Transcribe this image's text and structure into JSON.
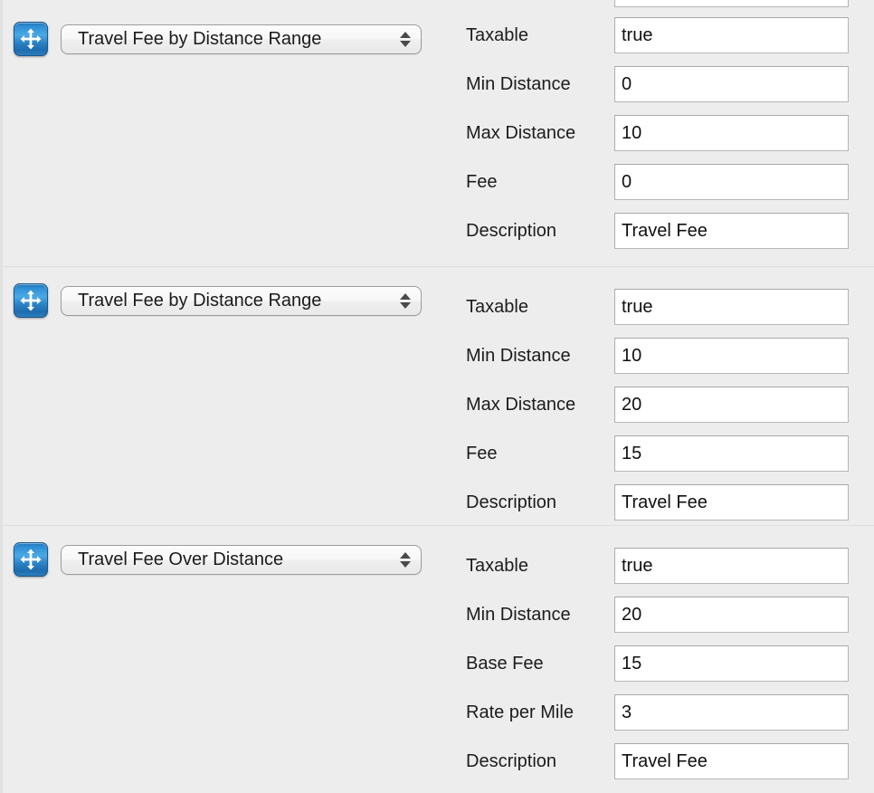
{
  "colors": {
    "page_background": "#ededed",
    "handle_blue": "#2f8fd4",
    "input_background": "#ffffff",
    "input_border": "#b7b7b7",
    "text": "#1c1c1c"
  },
  "top_clipped_field": {
    "name": "clipped-field-above",
    "value": ""
  },
  "groups": [
    {
      "handle_icon": "move-arrows-icon",
      "type_label": "Travel Fee by Distance Range",
      "fields": [
        {
          "label": "Taxable",
          "value": "true"
        },
        {
          "label": "Min Distance",
          "value": "0"
        },
        {
          "label": "Max Distance",
          "value": "10"
        },
        {
          "label": "Fee",
          "value": "0"
        },
        {
          "label": "Description",
          "value": "Travel Fee"
        }
      ]
    },
    {
      "handle_icon": "move-arrows-icon",
      "type_label": "Travel Fee by Distance Range",
      "fields": [
        {
          "label": "Taxable",
          "value": "true"
        },
        {
          "label": "Min Distance",
          "value": "10"
        },
        {
          "label": "Max Distance",
          "value": "20"
        },
        {
          "label": "Fee",
          "value": "15"
        },
        {
          "label": "Description",
          "value": "Travel Fee"
        }
      ]
    },
    {
      "handle_icon": "move-arrows-icon",
      "type_label": "Travel Fee Over Distance",
      "fields": [
        {
          "label": "Taxable",
          "value": "true"
        },
        {
          "label": "Min Distance",
          "value": "20"
        },
        {
          "label": "Base Fee",
          "value": "15"
        },
        {
          "label": "Rate per Mile",
          "value": "3"
        },
        {
          "label": "Description",
          "value": "Travel Fee"
        }
      ]
    }
  ]
}
